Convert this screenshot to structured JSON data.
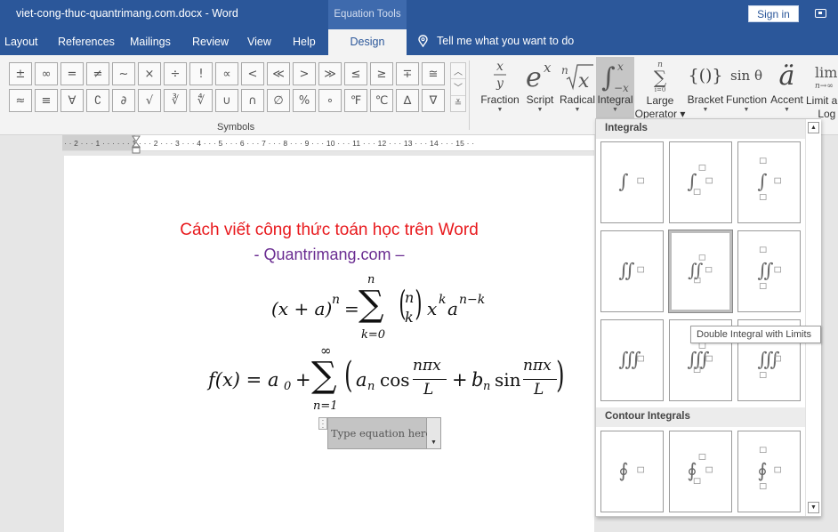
{
  "window": {
    "title": "viet-cong-thuc-quantrimang.com.docx  -  Word",
    "context_tab_group": "Equation Tools",
    "sign_in_label": "Sign in"
  },
  "tabs": [
    {
      "label": "Layout"
    },
    {
      "label": "References"
    },
    {
      "label": "Mailings"
    },
    {
      "label": "Review"
    },
    {
      "label": "View"
    },
    {
      "label": "Help"
    },
    {
      "label": "Design",
      "active": true
    }
  ],
  "tell_me": {
    "placeholder": "Tell me what you want to do",
    "icon": "lightbulb-icon"
  },
  "symbols": {
    "group_label": "Symbols",
    "row1": [
      "±",
      "∞",
      "=",
      "≠",
      "~",
      "×",
      "÷",
      "!",
      "∝",
      "<",
      "≪",
      ">",
      "≫",
      "≤",
      "≥",
      "∓",
      "≅"
    ],
    "row2": [
      "≈",
      "≡",
      "∀",
      "∁",
      "∂",
      "√",
      "∛",
      "∜",
      "∪",
      "∩",
      "∅",
      "%",
      "∘",
      "℉",
      "℃",
      "∆",
      "∇"
    ],
    "scroll": [
      "up-arrow-icon",
      "down-arrow-icon",
      "more-icon"
    ]
  },
  "structures": [
    {
      "label": "Fraction",
      "glyph": "x/y"
    },
    {
      "label": "Script",
      "glyph": "eˣ"
    },
    {
      "label": "Radical",
      "glyph": "ⁿ√x"
    },
    {
      "label": "Integral",
      "glyph": "∫",
      "active": true
    },
    {
      "label": "Large Operator",
      "glyph": "∑"
    },
    {
      "label": "Bracket",
      "glyph": "{()}"
    },
    {
      "label": "Function",
      "glyph": "sin θ"
    },
    {
      "label": "Accent",
      "glyph": "ä"
    },
    {
      "label": "Limit and Log",
      "glyph": "lim"
    }
  ],
  "ruler": {
    "text": "· · 2 · · · 1 · · ·   · · · 1 · · · 2 · · · 3 · · · 4 · · · 5 · · · 6 · · · 7 · · · 8 · · · 9 · · · 10 · · · 11 · · · 12 · · · 13 · · · 14 · · · 15 · ·"
  },
  "document": {
    "title": "Cách viết công thức toán học trên Word",
    "subtitle": "- Quantrimang.com –",
    "equation_1": {
      "lhs": "(x + a)",
      "lhs_exp": "n",
      "eq": "=",
      "sum_upper": "n",
      "sum_lower": "k=0",
      "binom_top": "n",
      "binom_bottom": "k",
      "term": "x",
      "term_exp": "k",
      "term2": "a",
      "term2_exp": "n−k"
    },
    "equation_2": {
      "lhs": "f(x) = a",
      "lhs_sub": "0",
      "plus": "+",
      "sum_upper": "∞",
      "sum_lower": "n=1",
      "a_n": "a",
      "n_sub": "n",
      "cos": "cos",
      "frac_num": "nπx",
      "frac_den": "L",
      "b_n": "b",
      "sin": "sin"
    },
    "equation_placeholder": "Type equation here."
  },
  "gallery": {
    "sections": [
      {
        "title": "Integrals",
        "items": [
          "Integral",
          "Integral with Subscript-Superscript Limits",
          "Integral with Limits",
          "Double Integral",
          "Double Integral with Subscript-Superscript Limits",
          "Double Integral with Limits",
          "Triple Integral",
          "Triple Integral with Subscript-Superscript Limits",
          "Triple Integral with Limits"
        ]
      },
      {
        "title": "Contour Integrals",
        "items": [
          "Contour Integral",
          "Contour Integral with Subscript-Superscript Limits",
          "Contour Integral with Limits"
        ]
      }
    ],
    "hovered_item": "Double Integral with Subscript-Superscript Limits",
    "tooltip": "Double Integral with Limits"
  }
}
